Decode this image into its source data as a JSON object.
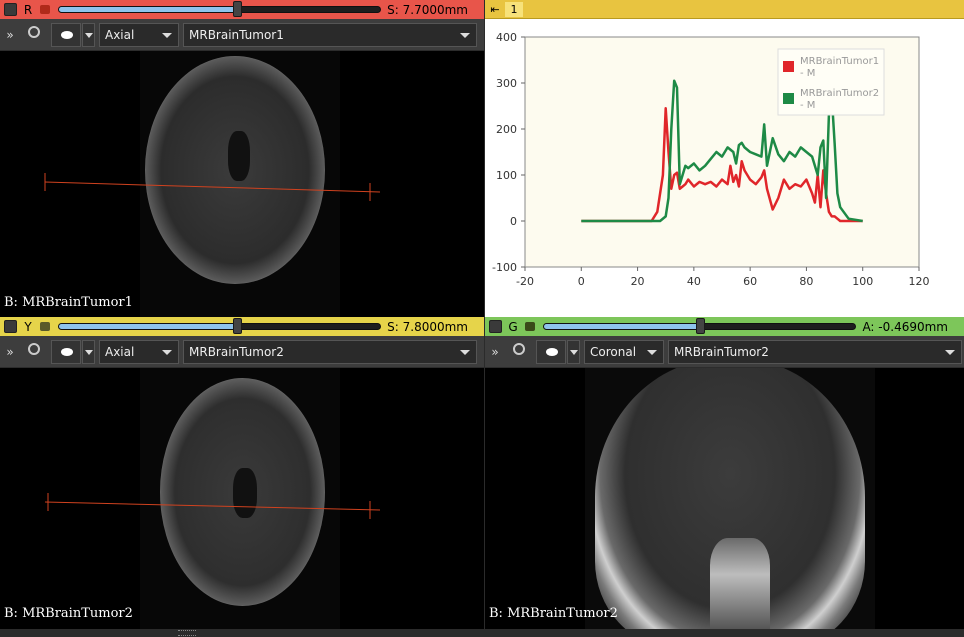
{
  "views": {
    "red": {
      "label": "R",
      "slice_offset": "S: 7.7000mm",
      "slider_fraction": 0.555,
      "orientation": "Axial",
      "volume": "MRBrainTumor1",
      "corner_label": "B: MRBrainTumor1",
      "bar_color": "#e8554a"
    },
    "yellow": {
      "label": "Y",
      "slice_offset": "S: 7.8000mm",
      "slider_fraction": 0.555,
      "orientation": "Axial",
      "volume": "MRBrainTumor2",
      "corner_label": "B: MRBrainTumor2",
      "bar_color": "#e6d44a"
    },
    "green": {
      "label": "G",
      "slice_offset": "A: -0.4690mm",
      "slider_fraction": 0.5,
      "orientation": "Coronal",
      "volume": "MRBrainTumor2",
      "corner_label": "B: MRBrainTumor2",
      "bar_color": "#7dc65a"
    },
    "chart": {
      "layout_number": "1",
      "bar_color": "#e8c440"
    }
  },
  "chart_data": {
    "type": "line",
    "xlim": [
      -20,
      120
    ],
    "ylim": [
      -100,
      400
    ],
    "xticks": [
      -20,
      0,
      20,
      40,
      60,
      80,
      100,
      120
    ],
    "yticks": [
      -100,
      0,
      100,
      200,
      300,
      400
    ],
    "legend_position": "top-right",
    "plot_background": "#fdfbef",
    "series": [
      {
        "name": "MRBrainTumor1 - M",
        "color": "#e0262a",
        "x": [
          0,
          5,
          10,
          15,
          20,
          25,
          27,
          29,
          30,
          31,
          32,
          33,
          34,
          35,
          36,
          37,
          38,
          40,
          42,
          44,
          46,
          48,
          50,
          52,
          53,
          54,
          55,
          56,
          57,
          58,
          60,
          62,
          64,
          65,
          66,
          68,
          70,
          72,
          74,
          76,
          78,
          80,
          82,
          83,
          84,
          85,
          86,
          87,
          88,
          89,
          90,
          91,
          92,
          95,
          100
        ],
        "y": [
          0,
          0,
          0,
          0,
          0,
          0,
          20,
          100,
          245,
          150,
          70,
          100,
          105,
          70,
          75,
          80,
          90,
          75,
          85,
          80,
          85,
          75,
          90,
          80,
          120,
          85,
          100,
          75,
          130,
          110,
          90,
          80,
          95,
          110,
          70,
          25,
          50,
          90,
          70,
          80,
          75,
          90,
          60,
          40,
          100,
          30,
          110,
          60,
          20,
          10,
          10,
          5,
          0,
          0,
          0
        ]
      },
      {
        "name": "MRBrainTumor2 - M",
        "color": "#1e8a46",
        "x": [
          0,
          5,
          10,
          15,
          20,
          25,
          28,
          30,
          31,
          32,
          33,
          34,
          35,
          36,
          37,
          38,
          40,
          42,
          44,
          46,
          48,
          50,
          52,
          54,
          55,
          56,
          57,
          58,
          60,
          62,
          64,
          65,
          66,
          68,
          70,
          72,
          74,
          76,
          78,
          80,
          82,
          84,
          85,
          86,
          87,
          88,
          89,
          90,
          91,
          92,
          95,
          100
        ],
        "y": [
          0,
          0,
          0,
          0,
          0,
          0,
          0,
          10,
          50,
          200,
          305,
          290,
          80,
          100,
          120,
          115,
          125,
          110,
          120,
          135,
          150,
          140,
          160,
          150,
          125,
          165,
          170,
          160,
          150,
          145,
          140,
          210,
          120,
          180,
          145,
          130,
          150,
          140,
          160,
          150,
          140,
          100,
          160,
          175,
          50,
          230,
          270,
          170,
          60,
          30,
          5,
          0
        ]
      }
    ]
  }
}
